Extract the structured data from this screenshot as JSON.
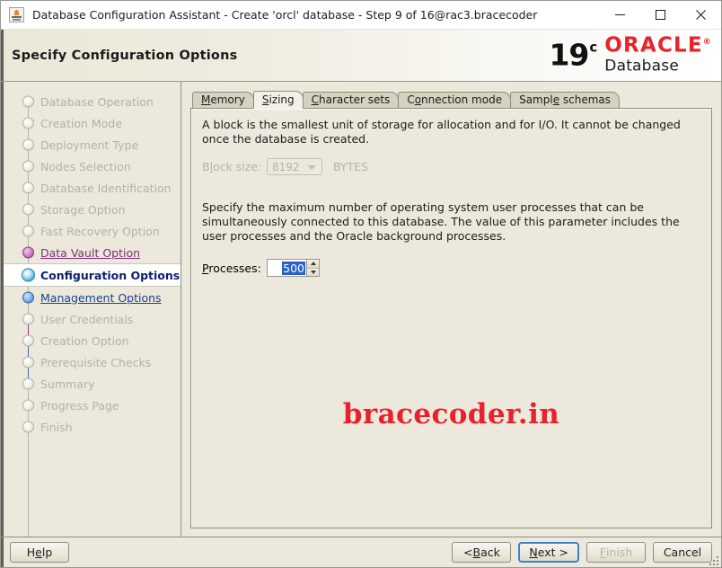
{
  "window": {
    "title": "Database Configuration Assistant - Create 'orcl' database - Step 9 of 16@rac3.bracecoder",
    "icon": "dbca-app-icon",
    "minimize_label": "Minimize",
    "maximize_label": "Maximize",
    "close_label": "Close"
  },
  "header": {
    "page_title": "Specify Configuration Options",
    "brand": {
      "version": "19",
      "version_sup": "c",
      "product": "ORACLE",
      "product_sup": "®",
      "subtitle": "Database",
      "red": "#e8242a"
    }
  },
  "sidebar": {
    "items": [
      {
        "label": "Database Operation",
        "state": "done"
      },
      {
        "label": "Creation Mode",
        "state": "done"
      },
      {
        "label": "Deployment Type",
        "state": "done"
      },
      {
        "label": "Nodes Selection",
        "state": "done"
      },
      {
        "label": "Database Identification",
        "state": "done"
      },
      {
        "label": "Storage Option",
        "state": "done"
      },
      {
        "label": "Fast Recovery Option",
        "state": "done"
      },
      {
        "label": "Data Vault Option",
        "state": "visited-purple"
      },
      {
        "label": "Configuration Options",
        "state": "current"
      },
      {
        "label": "Management Options",
        "state": "visited-blue"
      },
      {
        "label": "User Credentials",
        "state": "done"
      },
      {
        "label": "Creation Option",
        "state": "done"
      },
      {
        "label": "Prerequisite Checks",
        "state": "done"
      },
      {
        "label": "Summary",
        "state": "done"
      },
      {
        "label": "Progress Page",
        "state": "done"
      },
      {
        "label": "Finish",
        "state": "done"
      }
    ]
  },
  "main": {
    "tabs": [
      {
        "label": "Memory",
        "mnemonic": "M",
        "active": false
      },
      {
        "label": "Sizing",
        "mnemonic": "S",
        "active": true
      },
      {
        "label": "Character sets",
        "mnemonic": "C",
        "active": false
      },
      {
        "label": "Connection mode",
        "mnemonic": "o",
        "active": false
      },
      {
        "label": "Sample schemas",
        "mnemonic": "e",
        "active": false
      }
    ],
    "sizing": {
      "block_description": "A block is the smallest unit of storage for allocation and for I/O. It cannot be changed once the database is created.",
      "block_size_label": "Block size:",
      "block_size_label_pre": "B",
      "block_size_label_mnemonic": "l",
      "block_size_label_post": "ock size:",
      "block_size_value": "8192",
      "block_size_units": "BYTES",
      "block_size_disabled": true,
      "processes_description": "Specify the maximum number of operating system user processes that can be simultaneously connected to this database. The value of this parameter includes the user processes and the Oracle background processes.",
      "processes_label_pre": "P",
      "processes_label_mnemonic": "",
      "processes_label_post": "rocesses:",
      "processes_label": "Processes:",
      "processes_value": "500",
      "processes_selected": true
    },
    "watermark": "bracecoder.in"
  },
  "footer": {
    "help": {
      "label": "Help",
      "pre": "H",
      "mnemonic": "e",
      "post": "lp"
    },
    "back": {
      "label": "< Back",
      "pre": "< ",
      "mnemonic": "B",
      "post": "ack"
    },
    "next": {
      "label": "Next >",
      "pre": "",
      "mnemonic": "N",
      "post": "ext >",
      "focused": true
    },
    "finish": {
      "label": "Finish",
      "pre": "",
      "mnemonic": "F",
      "post": "inish",
      "disabled": true
    },
    "cancel": {
      "label": "Cancel",
      "pre": "",
      "mnemonic": "",
      "post": "Cancel"
    }
  }
}
